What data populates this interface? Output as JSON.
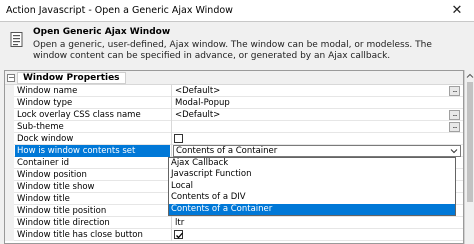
{
  "window": {
    "title": "Action Javascript - Open a Generic Ajax Window",
    "close_glyph": "✕"
  },
  "description": {
    "heading": "Open Generic Ajax Window",
    "body": "Open a generic, user-defined, Ajax window. The window can be modal, or modeless. The window content can be specified in advance, or generated by an Ajax callback."
  },
  "grid": {
    "section_label": "Window Properties",
    "rows": [
      {
        "name": "Window name",
        "value": "<Default>",
        "button": "..."
      },
      {
        "name": "Window type",
        "value": "Modal-Popup"
      },
      {
        "name": "Lock overlay CSS class name",
        "value": "<Default>",
        "button": "..."
      },
      {
        "name": "Sub-theme",
        "value": "",
        "button": "..."
      },
      {
        "name": "Dock window",
        "value": "",
        "checkbox": false
      },
      {
        "name": "How is window contents set",
        "value": "Contents of a Container",
        "selected": true
      },
      {
        "name": "Container id",
        "value": ""
      },
      {
        "name": "Window position",
        "value": ""
      },
      {
        "name": "Window title show",
        "value": ""
      },
      {
        "name": "Window title",
        "value": ""
      },
      {
        "name": "Window title position",
        "value": ""
      },
      {
        "name": "Window title direction",
        "value": "ltr"
      },
      {
        "name": "Window title has close button",
        "value": "",
        "checkbox": true
      }
    ]
  },
  "dropdown": {
    "options": [
      "Ajax Callback",
      "Javascript Function",
      "Local",
      "Contents of a DIV",
      "Contents of a Container"
    ],
    "highlighted_index": 4
  },
  "colors": {
    "selection": "#0078d7"
  }
}
